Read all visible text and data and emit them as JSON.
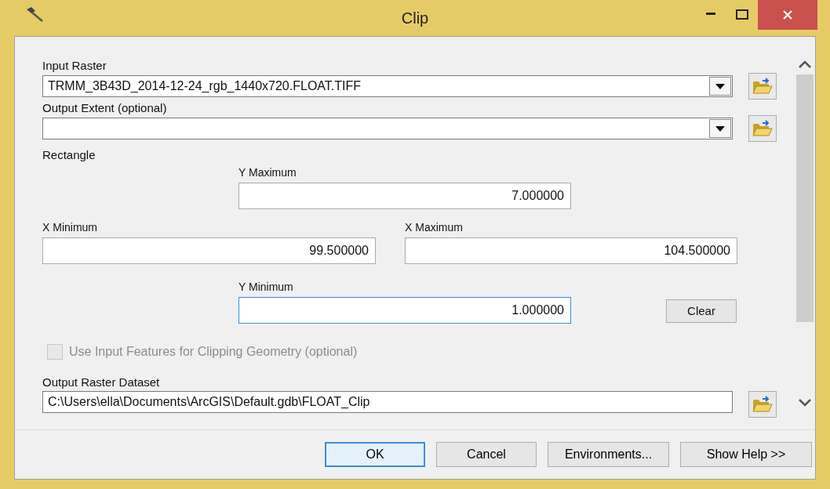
{
  "window": {
    "title": "Clip"
  },
  "input_raster": {
    "label": "Input Raster",
    "value": "TRMM_3B43D_2014-12-24_rgb_1440x720.FLOAT.TIFF"
  },
  "output_extent": {
    "label": "Output Extent (optional)"
  },
  "rectangle": {
    "label": "Rectangle",
    "y_maximum": {
      "label": "Y Maximum",
      "value": "7.000000",
      "focused": false
    },
    "x_minimum": {
      "label": "X Minimum",
      "value": "99.500000",
      "focused": false
    },
    "x_maximum": {
      "label": "X Maximum",
      "value": "104.500000",
      "focused": false
    },
    "y_minimum": {
      "label": "Y Minimum",
      "value": "1.000000",
      "focused": true
    },
    "clear_button": "Clear"
  },
  "use_input_features": {
    "label": "Use Input Features for Clipping Geometry (optional)",
    "checked": false,
    "disabled": true
  },
  "output_raster": {
    "label": "Output Raster Dataset",
    "value": "C:\\Users\\ella\\Documents\\ArcGIS\\Default.gdb\\FLOAT_Clip"
  },
  "buttons": [
    {
      "label": "OK",
      "default": true
    },
    {
      "label": "Cancel",
      "default": false
    },
    {
      "label": "Environments...",
      "default": false
    },
    {
      "label": "Show Help >>",
      "default": false
    }
  ]
}
